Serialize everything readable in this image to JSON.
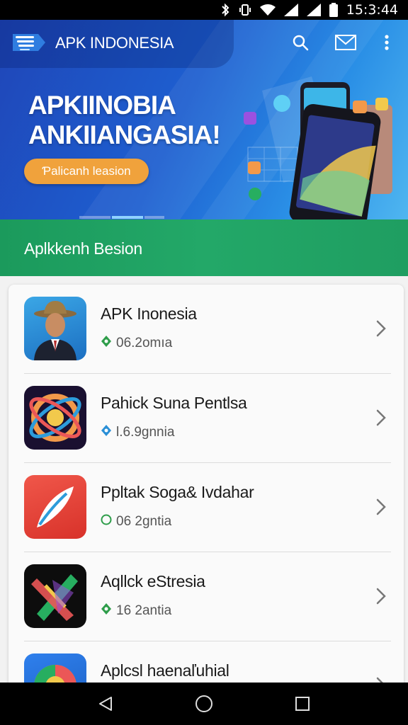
{
  "status_bar": {
    "time": "15:3:44",
    "icons": [
      "bluetooth-icon",
      "vibrate-icon",
      "wifi-icon",
      "signal-icon",
      "signal-icon",
      "battery-icon"
    ]
  },
  "app_bar": {
    "title": "APK INDONESIA",
    "actions": [
      "search-icon",
      "mail-icon",
      "more-vert-icon"
    ]
  },
  "hero": {
    "title_line1": "APKIINOBIA",
    "title_line2": "ANKIIANGASIA!",
    "button_label": "Ƥalicanh leasion",
    "carousel_active_index": 1,
    "carousel_count": 3
  },
  "section": {
    "title": "Aplkkenh Besion"
  },
  "apps": [
    {
      "name": "APK Inonesia",
      "meta": "06.2omıa",
      "icon": "person-avatar-icon",
      "badge_color": "#2e9d4a"
    },
    {
      "name": "Pahick Suna Pentlsa",
      "meta": "l.6.9gnnia",
      "icon": "orbit-logo-icon",
      "badge_color": "#2a8fd6"
    },
    {
      "name": "Ppltak Soga& Ivdahar",
      "meta": "06 2gntia",
      "icon": "feather-icon",
      "badge_color": "#2e9d4a"
    },
    {
      "name": "Aqllck eStresia",
      "meta": "16 2antia",
      "icon": "pencil-ruler-icon",
      "badge_color": "#2e9d4a"
    },
    {
      "name": "Aplcsl haenaľuhial",
      "meta": "",
      "icon": "color-wheel-icon",
      "badge_color": "#2e9d4a"
    }
  ],
  "nav_bar": [
    "back-icon",
    "home-icon",
    "recents-icon"
  ],
  "colors": {
    "hero_blue": "#1e5fd0",
    "accent_orange": "#f0a23c",
    "section_green": "#23a868",
    "card_bg": "#fafafa"
  }
}
